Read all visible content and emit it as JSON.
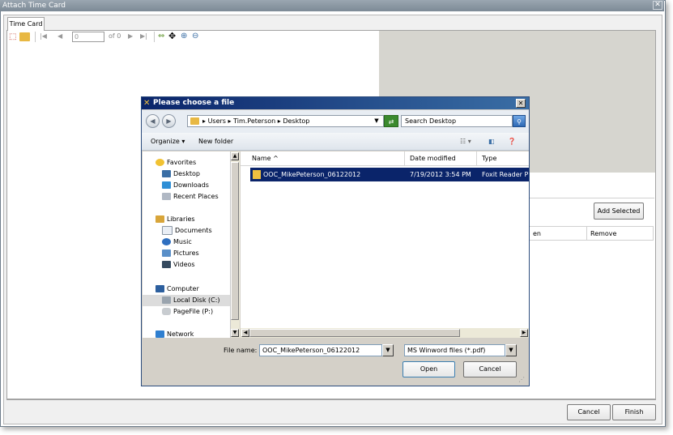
{
  "outer": {
    "title": "Attach Time Card",
    "close": "✕",
    "tab": "Time Card",
    "toolbar": {
      "page_input": "0",
      "of_label": "of 0"
    },
    "add_selected": "Add Selected",
    "grid_cols": [
      "en",
      "Remove"
    ],
    "cancel": "Cancel",
    "finish": "Finish"
  },
  "dialog": {
    "title": "Please choose a file",
    "close": "✕",
    "breadcrumb": [
      "Users",
      "Tim.Peterson",
      "Desktop"
    ],
    "search_placeholder": "Search Desktop",
    "organize": "Organize",
    "new_folder": "New folder",
    "nav": {
      "favorites": "Favorites",
      "fav_items": [
        "Desktop",
        "Downloads",
        "Recent Places"
      ],
      "libraries": "Libraries",
      "lib_items": [
        "Documents",
        "Music",
        "Pictures",
        "Videos"
      ],
      "computer": "Computer",
      "comp_items": [
        "Local Disk (C:)",
        "PageFile (P:)"
      ],
      "network": "Network"
    },
    "columns": {
      "name": "Name",
      "date": "Date modified",
      "type": "Type"
    },
    "file": {
      "name": "OOC_MikePeterson_06122012",
      "date": "7/19/2012 3:54 PM",
      "type": "Foxit Reader PD"
    },
    "file_name_label": "File name:",
    "file_name_value": "OOC_MikePeterson_06122012",
    "file_type_value": "MS Winword files (*.pdf)",
    "open": "Open",
    "cancel": "Cancel"
  },
  "colors": {
    "selection": "#0a246a",
    "title_bar": "#0a246a",
    "dialog_face": "#d4d0c8"
  }
}
